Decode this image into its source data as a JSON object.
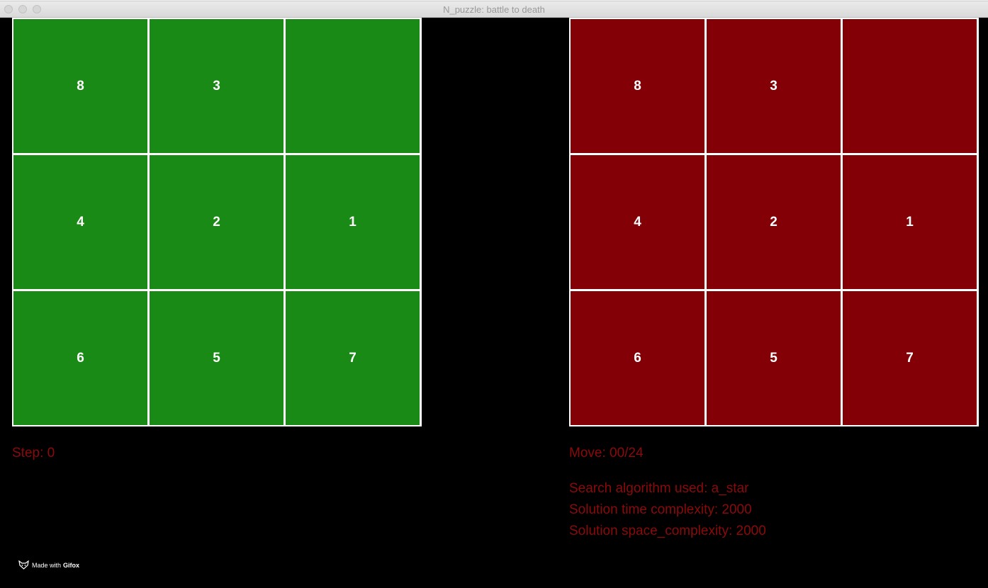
{
  "window": {
    "title": "N_puzzle: battle to death"
  },
  "left_board": {
    "tiles": [
      "8",
      "3",
      "",
      "4",
      "2",
      "1",
      "6",
      "5",
      "7"
    ]
  },
  "right_board": {
    "tiles": [
      "8",
      "3",
      "",
      "4",
      "2",
      "1",
      "6",
      "5",
      "7"
    ]
  },
  "info": {
    "step": "Step: 0",
    "move": "Move: 00/24",
    "algorithm": "Search algorithm used: a_star",
    "time_complexity": "Solution time complexity: 2000",
    "space_complexity": "Solution space_complexity: 2000"
  },
  "watermark": {
    "prefix": "Made with",
    "brand": "Gifox"
  },
  "colors": {
    "left_tile": "#1a8a16",
    "right_tile": "#830007",
    "info_text": "#8b0a0a"
  }
}
